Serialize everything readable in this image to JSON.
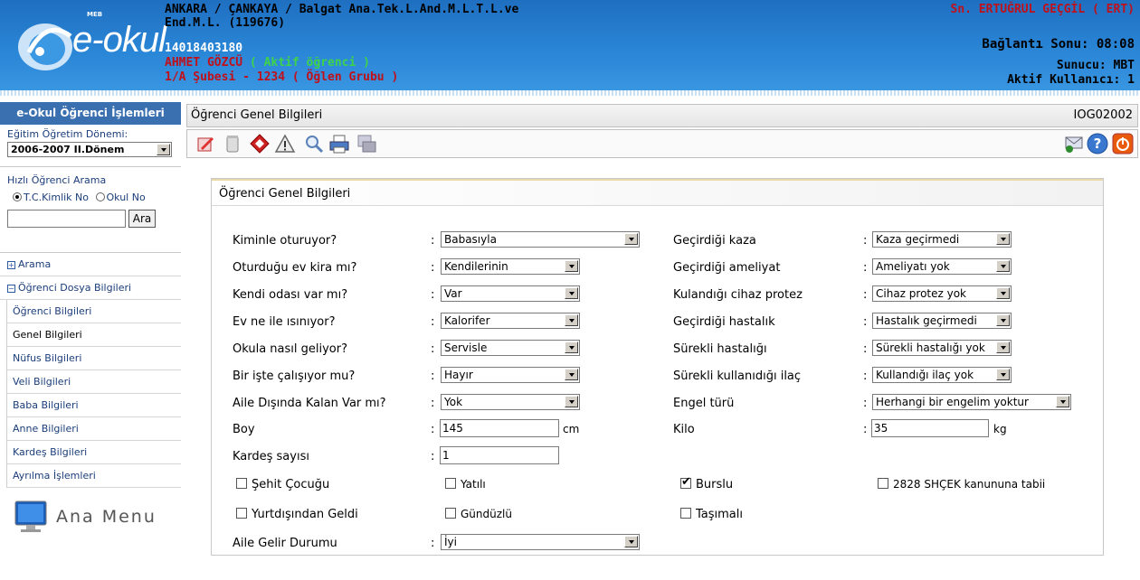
{
  "header": {
    "logo_text": "e-okul",
    "logo_small": "MEB",
    "school_line1": "ANKARA / ÇANKAYA / Balgat Ana.Tek.L.And.M.L.T.L.ve",
    "school_line2": "End.M.L. (119676)",
    "student_id": "14018403180",
    "student_name": "AHMET GÖZCÜ",
    "student_status": "( Aktif öğrenci )",
    "class_info": "1/A Şubesi - 1234  ( Öğlen Grubu )",
    "user": "Sn. ERTUĞRUL GEÇGİL ( ERT)",
    "connection": "Bağlantı Sonu: 08:08",
    "server": "Sunucu: MBT",
    "active_users": "Aktif Kullanıcı: 1"
  },
  "sidebar": {
    "title": "e-Okul Öğrenci İşlemleri",
    "term_label": "Eğitim Öğretim Dönemi:",
    "term_value": "2006-2007 II.Dönem",
    "quick_search_label": "Hızlı Öğrenci Arama",
    "radio_tc": "T.C.Kimlik No",
    "radio_okul": "Okul No",
    "search_value": "",
    "search_button": "Ara",
    "nav": [
      {
        "label": "Arama",
        "icon": "plus"
      },
      {
        "label": "Öğrenci Dosya Bilgileri",
        "icon": "minus"
      },
      {
        "label": "Öğrenci Bilgileri"
      },
      {
        "label": "Genel Bilgileri"
      },
      {
        "label": "Nüfus Bilgileri"
      },
      {
        "label": "Veli Bilgileri"
      },
      {
        "label": "Baba Bilgileri"
      },
      {
        "label": "Anne Bilgileri"
      },
      {
        "label": "Kardeş Bilgileri"
      },
      {
        "label": "Ayrılma İşlemleri"
      }
    ],
    "ana_menu": "Ana Menu"
  },
  "page": {
    "title": "Öğrenci Genel Bilgileri",
    "code": "IOG02002"
  },
  "toolbar": {
    "icons": [
      "edit-icon",
      "delete-icon",
      "clear-icon",
      "warning-icon",
      "preview-icon",
      "print-icon",
      "transfer-icon",
      "messages-icon",
      "help-icon",
      "exit-icon"
    ]
  },
  "form": {
    "heading": "Öğrenci Genel Bilgileri",
    "left": [
      {
        "label": "Kiminle oturuyor?",
        "value": "Babasıyla"
      },
      {
        "label": "Oturduğu ev kira mı?",
        "value": "Kendilerinin"
      },
      {
        "label": "Kendi odası var mı?",
        "value": "Var"
      },
      {
        "label": "Ev ne ile ısınıyor?",
        "value": "Kalorifer"
      },
      {
        "label": "Okula nasıl geliyor?",
        "value": "Servisle"
      },
      {
        "label": "Bir işte çalışıyor mu?",
        "value": "Hayır"
      },
      {
        "label": "Aile Dışında Kalan Var mı?",
        "value": "Yok"
      }
    ],
    "right": [
      {
        "label": "Geçirdiği kaza",
        "value": "Kaza geçirmedi"
      },
      {
        "label": "Geçirdiği ameliyat",
        "value": "Ameliyatı yok"
      },
      {
        "label": "Kulandığı cihaz protez",
        "value": "Cihaz protez yok"
      },
      {
        "label": "Geçirdiği hastalık",
        "value": "Hastalık geçirmedi"
      },
      {
        "label": "Sürekli hastalığı",
        "value": "Sürekli hastalığı yok"
      },
      {
        "label": "Sürekli kullanıdığı ilaç",
        "value": "Kullandığı ilaç yok"
      },
      {
        "label": "Engel türü",
        "value": "Herhangi bir engelim yoktur"
      }
    ],
    "boy_label": "Boy",
    "boy_value": "145",
    "boy_unit": "cm",
    "kilo_label": "Kilo",
    "kilo_value": "35",
    "kilo_unit": "kg",
    "kardes_label": "Kardeş sayısı",
    "kardes_value": "1",
    "checkboxes": [
      {
        "label": "Şehit Çocuğu",
        "checked": false
      },
      {
        "label": "Yatılı",
        "checked": false
      },
      {
        "label": "Burslu",
        "checked": true
      },
      {
        "label": "2828 SHÇEK kanununa tabii",
        "checked": false
      },
      {
        "label": "Yurtdışından Geldi",
        "checked": false
      },
      {
        "label": "Gündüzlü",
        "checked": false
      },
      {
        "label": "Taşımalı",
        "checked": false
      }
    ],
    "gelir_label": "Aile Gelir Durumu",
    "gelir_value": "İyi",
    "colon": ":"
  }
}
